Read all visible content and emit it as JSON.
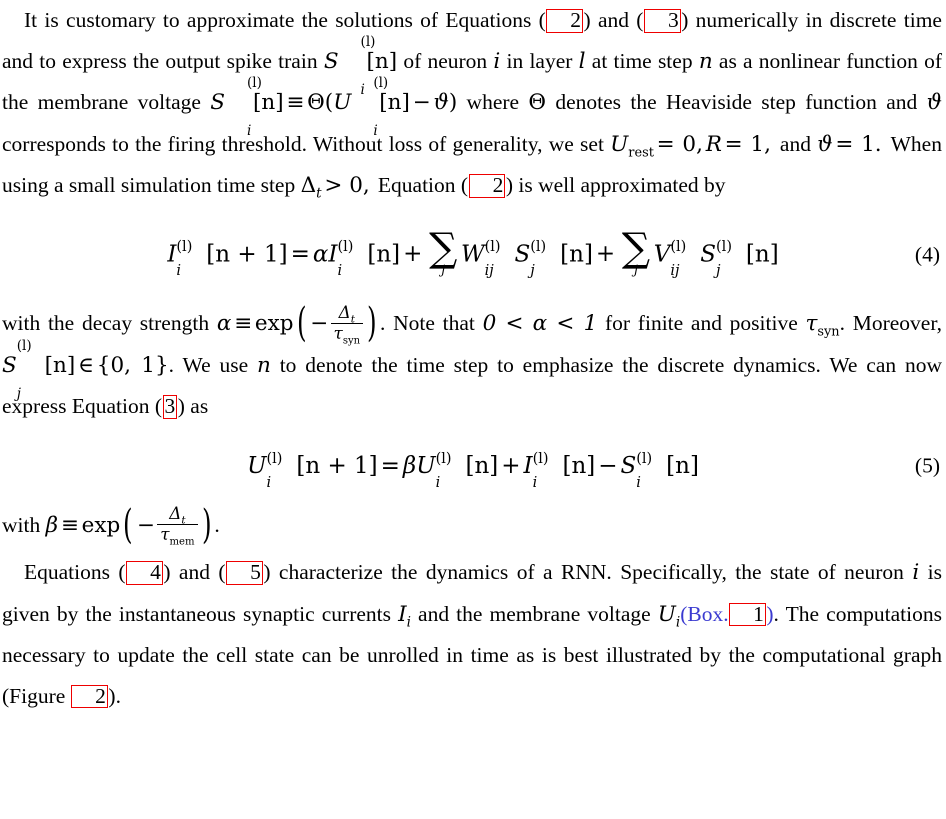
{
  "document": {
    "type": "academic-paper-page",
    "background_color": "#ffffff",
    "text_color": "#000000",
    "link_box_color": "#ee0000",
    "link_text_color": "#3a3ad0"
  },
  "paragraphs": {
    "p1": {
      "s1": "It is customary to approximate the solutions of Equations (",
      "ref_eq2a": "2",
      "s2": ") and (",
      "ref_eq3a": "3",
      "s3": ") numerically in discrete time and to express the output spike train ",
      "math_S": "S",
      "math_S_sup": "(l)",
      "math_S_sub": "i",
      "math_S_brk": "[n]",
      "s4": " of neuron ",
      "math_i": "i",
      "s5": " in layer ",
      "math_l": "l",
      "s6": " at time step ",
      "math_n": "n",
      "s7": " as a nonlinear function of the membrane voltage ",
      "math_S2": "S",
      "math_S2_sup": "(l)",
      "math_S2_sub": "i",
      "math_S2_brk": "[n]",
      "equiv": "≡",
      "theta_cap": "Θ",
      "open_paren": "(",
      "math_U": "U",
      "math_U_sup": "(l)",
      "math_U_sub": "i",
      "math_U_brk": "[n]",
      "minus": "−",
      "vartheta": "ϑ",
      "close_paren": ")",
      "s8": " where ",
      "theta_cap2": "Θ",
      "s9": " denotes the Heaviside step function and ",
      "vartheta2": "ϑ",
      "s10": " corresponds to the firing threshold. Without loss of generality, we set ",
      "math_Urest": "U",
      "math_Urest_sub": "rest",
      "eq0": "= 0,",
      "math_R": "R",
      "eq1": "= 1,",
      "s11": " and ",
      "vartheta3": "ϑ",
      "eq2": "= 1.",
      "s12": " When using a small simulation time step ",
      "math_Delta": "Δ",
      "math_Delta_sub": "t",
      "gt0": "> 0,",
      "s13": " Equation (",
      "ref_eq2b": "2",
      "s14": ") is well approximated by"
    },
    "p2": {
      "s1": "with the decay strength ",
      "alpha": "α",
      "equiv": "≡",
      "exp": "exp",
      "minus": "−",
      "frac_num": "Δ",
      "frac_num_sub": "t",
      "frac_den": "τ",
      "frac_den_sub": "syn",
      "s2": ". Note that ",
      "ineq": "0 < α < 1",
      "s3": " for finite and positive ",
      "tau": "τ",
      "tau_sub": "syn",
      "s4": ". Moreover, ",
      "math_S": "S",
      "math_S_sup": "(l)",
      "math_S_sub": "j",
      "math_S_brk": "[n]",
      "elem": "∈",
      "set": "{0, 1}",
      "s5": ". We use ",
      "math_n": "n",
      "s6": " to denote the time step to emphasize the discrete dynamics. We can now express Equation (",
      "ref_eq3b": "3",
      "s7": ") as"
    },
    "p3": {
      "s1": "with ",
      "beta": "β",
      "equiv": "≡",
      "exp": "exp",
      "minus": "−",
      "frac_num": "Δ",
      "frac_num_sub": "t",
      "frac_den": "τ",
      "frac_den_sub": "mem",
      "s2": "."
    },
    "p4": {
      "s1": "Equations (",
      "ref_eq4": "4",
      "s2": ") and (",
      "ref_eq5": "5",
      "s3": ") characterize the dynamics of a RNN. Specifically, the state of neuron ",
      "math_i": "i",
      "s4": " is given by the instantaneous synaptic currents ",
      "math_I": "I",
      "math_I_sub": "i",
      "s5": " and the membrane voltage ",
      "math_U": "U",
      "math_U_sub": "i",
      "box_open": "(Box.",
      "ref_box1": "1",
      "box_close": ")",
      "s6": ". The computations necessary to update the cell state can be unrolled in time as is best illustrated by the computational graph (Figure ",
      "ref_fig2": "2",
      "s7": ")."
    }
  },
  "equations": {
    "eq4": {
      "number": "(4)",
      "lhs_var": "I",
      "lhs_sup": "(l)",
      "lhs_sub": "i",
      "lhs_brk": "[n + 1]",
      "eq": "=",
      "alpha": "α",
      "t1_var": "I",
      "t1_sup": "(l)",
      "t1_sub": "i",
      "t1_brk": "[n]",
      "plus1": "+",
      "sum1_sym": "∑",
      "sum1_idx": "j",
      "W_var": "W",
      "W_sup": "(l)",
      "W_sub": "ij",
      "S1_var": "S",
      "S1_sup": "(l)",
      "S1_sub": "j",
      "S1_brk": "[n]",
      "plus2": "+",
      "sum2_sym": "∑",
      "sum2_idx": "j",
      "V_var": "V",
      "V_sup": "(l)",
      "V_sub": "ij",
      "S2_var": "S",
      "S2_sup": "(l)",
      "S2_sub": "j",
      "S2_brk": "[n]"
    },
    "eq5": {
      "number": "(5)",
      "lhs_var": "U",
      "lhs_sup": "(l)",
      "lhs_sub": "i",
      "lhs_brk": "[n + 1]",
      "eq": "=",
      "beta": "β",
      "t1_var": "U",
      "t1_sup": "(l)",
      "t1_sub": "i",
      "t1_brk": "[n]",
      "plus": "+",
      "t2_var": "I",
      "t2_sup": "(l)",
      "t2_sub": "i",
      "t2_brk": "[n]",
      "minus": "−",
      "t3_var": "S",
      "t3_sup": "(l)",
      "t3_sub": "i",
      "t3_brk": "[n]"
    }
  }
}
